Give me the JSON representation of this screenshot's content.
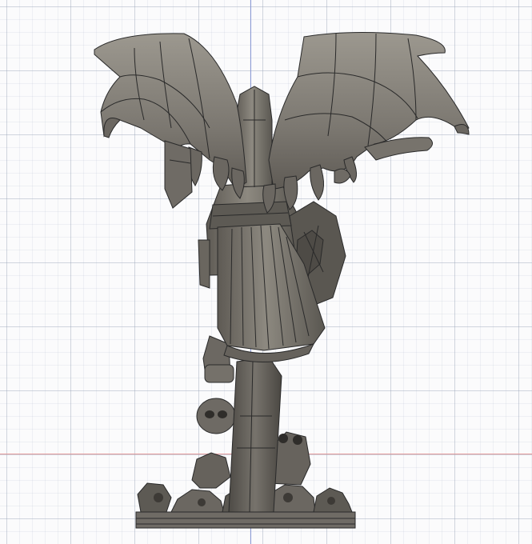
{
  "viewport": {
    "view": "front",
    "background_color": "#fbfbfc",
    "grid_color": "#c8cfdc",
    "vertical_axis_color": "#8c9bd6",
    "horizontal_axis_color": "#e49a9a"
  },
  "model": {
    "body_color": "#7a766f",
    "shadow_color": "#4d4a45",
    "highlight_color": "#a9a59c",
    "edge_color": "#2a2a2a"
  }
}
